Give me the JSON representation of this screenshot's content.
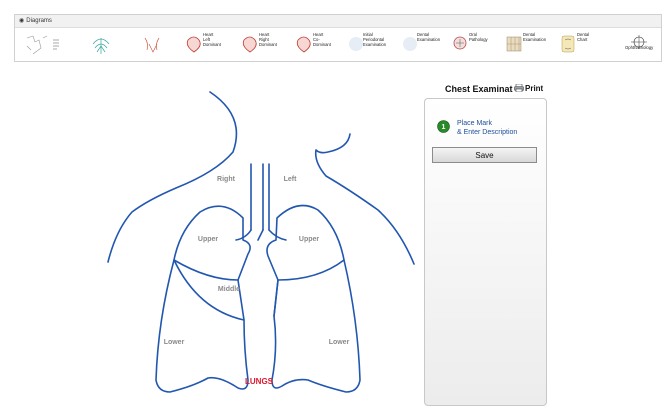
{
  "diagrams_panel": {
    "header_label": "Diagrams",
    "thumbnails": [
      {
        "label": ""
      },
      {
        "label": ""
      },
      {
        "label": ""
      },
      {
        "label": "Heart\nLeft\nDominant"
      },
      {
        "label": "Heart\nRight\nDominant"
      },
      {
        "label": "Heart\nCo-\nDominant"
      },
      {
        "label": "Initial\nPeriodontal\nExamination"
      },
      {
        "label": "Dental\nExamination"
      },
      {
        "label": "Oral\nPathology"
      },
      {
        "label": "Dental\nExamination"
      },
      {
        "label": "Dental\nChart"
      },
      {
        "label": "Ophthalmology"
      }
    ]
  },
  "diagram": {
    "labels": {
      "right": "Right",
      "left": "Left",
      "upper_right": "Upper",
      "upper_left": "Upper",
      "middle": "Middle",
      "lower_right": "Lower",
      "lower_left": "Lower"
    },
    "title": "LUNGS",
    "stroke_color": "#2257b0",
    "title_color": "#e0182d"
  },
  "side_panel": {
    "title": "Chest Examinat",
    "print_label": "Print",
    "place_mark_line1": "Place Mark",
    "place_mark_line2": "& Enter Description",
    "save_label": "Save"
  }
}
